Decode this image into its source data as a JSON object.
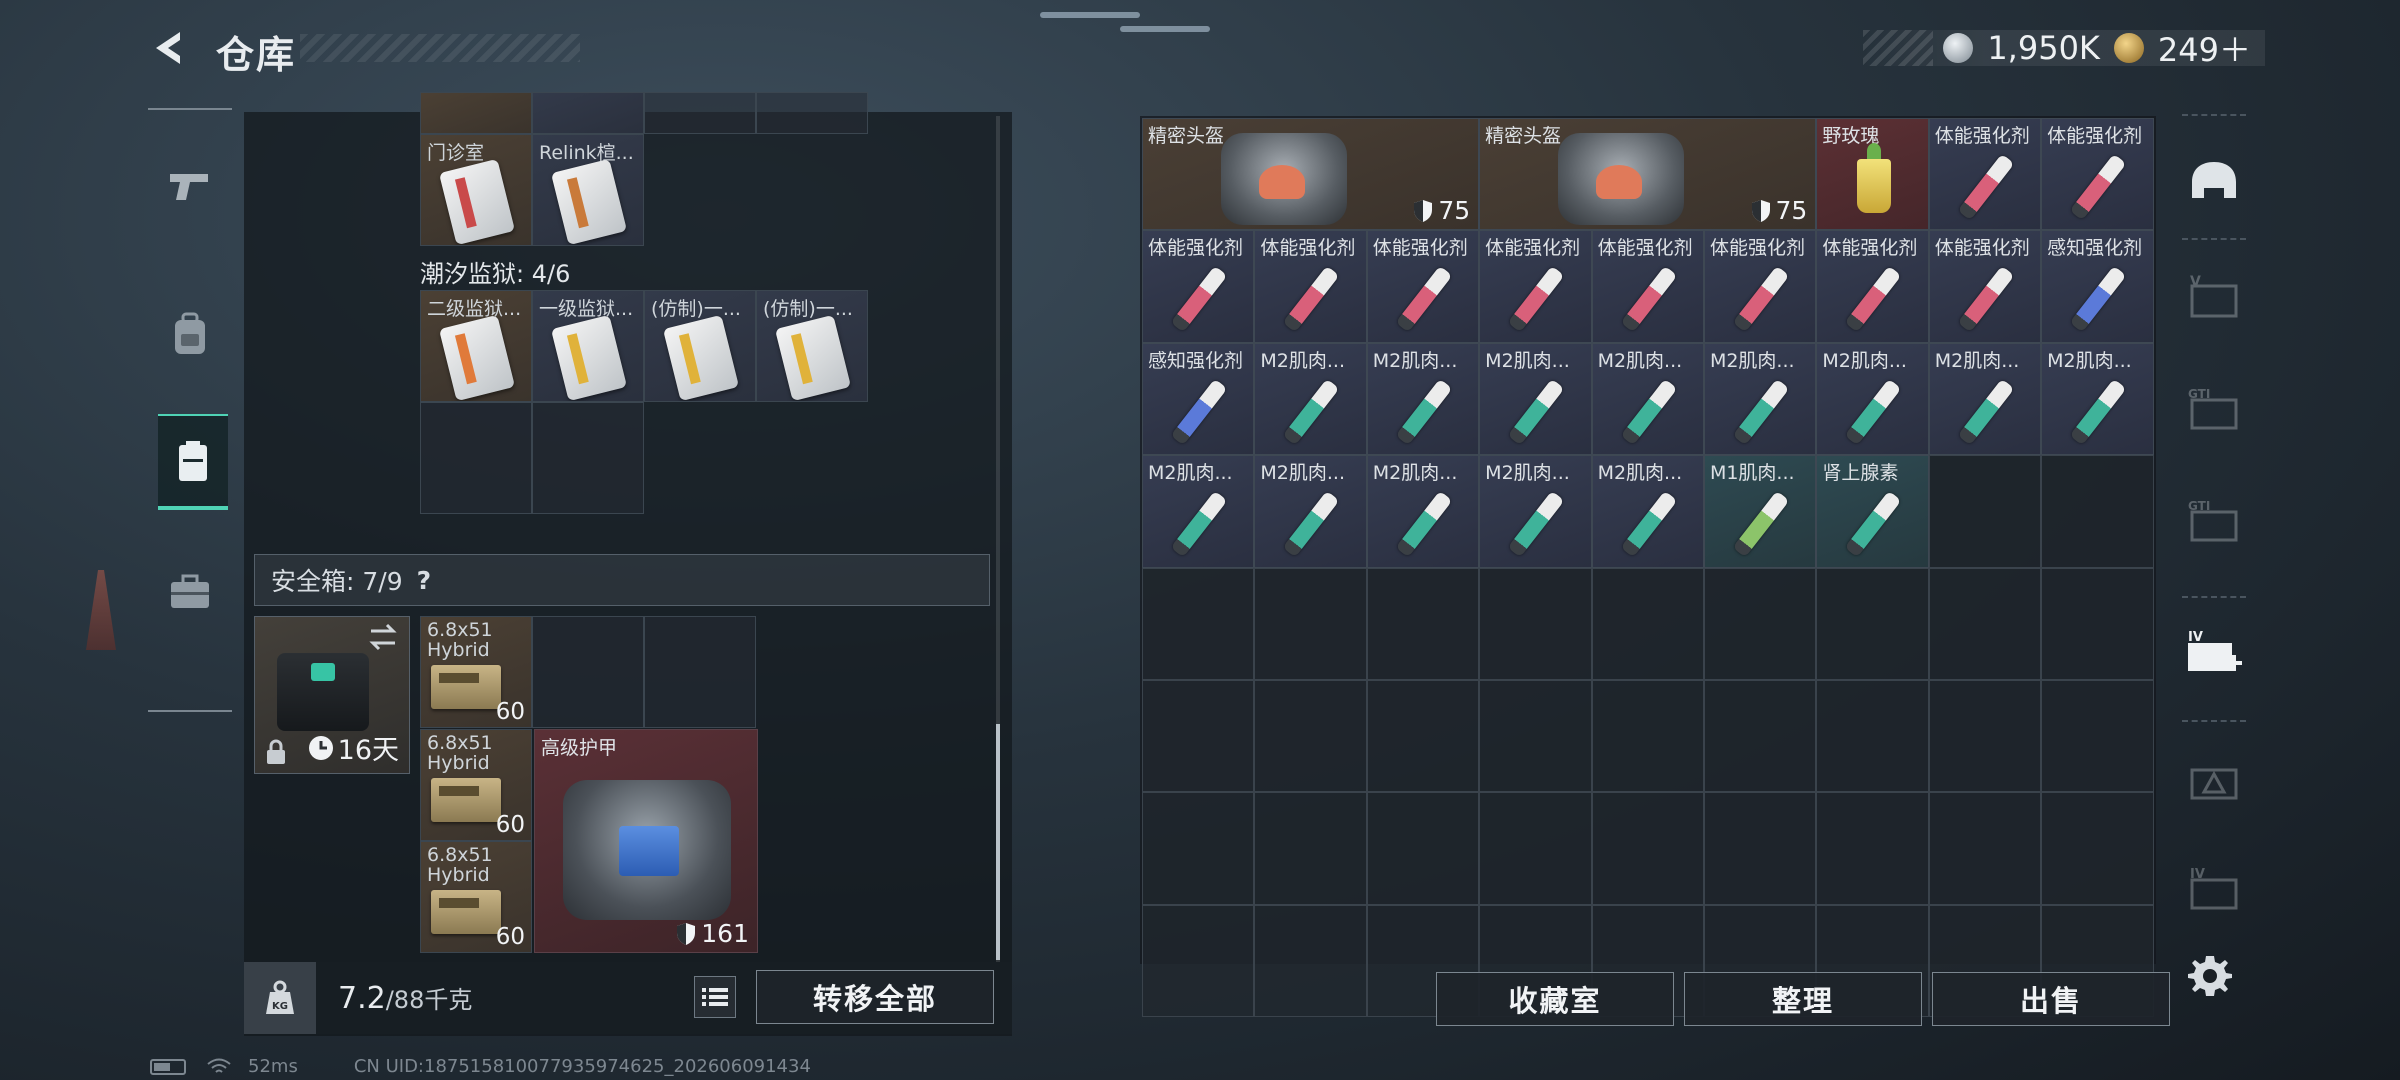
{
  "header": {
    "title": "仓库",
    "currency": [
      {
        "icon": "silver-coin-icon",
        "value": "1,950K"
      },
      {
        "icon": "gold-coin-icon",
        "value": "249＋"
      }
    ]
  },
  "left_nav": [
    {
      "icon": "pistol-icon",
      "active": false
    },
    {
      "icon": "backpack-icon",
      "active": false
    },
    {
      "icon": "storage-locker-icon",
      "active": true
    },
    {
      "icon": "briefcase-icon",
      "active": false
    }
  ],
  "left_panel": {
    "top_items": [
      {
        "label": "门诊室",
        "color": "#c94a4a"
      },
      {
        "label": "Relink楦...",
        "color": "#c97a3a"
      }
    ],
    "prison_section": {
      "title": "潮汐监狱: 4/6",
      "items": [
        {
          "label": "二级监狱...",
          "color": "#e07a3a"
        },
        {
          "label": "一级监狱...",
          "color": "#e0b23a"
        },
        {
          "label": "(仿制)一...",
          "color": "#e0b23a"
        },
        {
          "label": "(仿制)一...",
          "color": "#e0b23a"
        }
      ]
    },
    "safe_box": {
      "title": "安全箱: 7/9",
      "help": "?",
      "timer": "16天",
      "ammo": [
        {
          "label": "6.8x51 Hybrid",
          "count": "60"
        },
        {
          "label": "6.8x51 Hybrid",
          "count": "60"
        },
        {
          "label": "6.8x51 Hybrid",
          "count": "60"
        }
      ],
      "armor": {
        "label": "高级护甲",
        "durability": "161"
      }
    },
    "footer": {
      "weight_value": "7.2",
      "weight_cap": "/88千克",
      "transfer_all": "转移全部"
    }
  },
  "stash": {
    "rows": [
      [
        {
          "label": "精密头盔",
          "kind": "helmet",
          "value": "75",
          "span": 3
        },
        {
          "label": "精密头盔",
          "kind": "helmet",
          "value": "75",
          "span": 3
        },
        {
          "label": "野玫瑰",
          "kind": "drink"
        },
        {
          "label": "体能强化剂",
          "kind": "syringe",
          "color": "#d9607a"
        },
        {
          "label": "体能强化剂",
          "kind": "syringe",
          "color": "#d9607a"
        }
      ],
      [
        {
          "label": "体能强化剂",
          "kind": "syringe",
          "color": "#d9607a"
        },
        {
          "label": "体能强化剂",
          "kind": "syringe",
          "color": "#d9607a"
        },
        {
          "label": "体能强化剂",
          "kind": "syringe",
          "color": "#d9607a"
        },
        {
          "label": "体能强化剂",
          "kind": "syringe",
          "color": "#d9607a"
        },
        {
          "label": "体能强化剂",
          "kind": "syringe",
          "color": "#d9607a"
        },
        {
          "label": "体能强化剂",
          "kind": "syringe",
          "color": "#d9607a"
        },
        {
          "label": "体能强化剂",
          "kind": "syringe",
          "color": "#d9607a"
        },
        {
          "label": "体能强化剂",
          "kind": "syringe",
          "color": "#d9607a"
        },
        {
          "label": "感知强化剂",
          "kind": "syringe",
          "color": "#5b7ad9"
        }
      ],
      [
        {
          "label": "感知强化剂",
          "kind": "syringe",
          "color": "#5b7ad9"
        },
        {
          "label": "M2肌肉...",
          "kind": "syringe",
          "color": "#3fb39a"
        },
        {
          "label": "M2肌肉...",
          "kind": "syringe",
          "color": "#3fb39a"
        },
        {
          "label": "M2肌肉...",
          "kind": "syringe",
          "color": "#3fb39a"
        },
        {
          "label": "M2肌肉...",
          "kind": "syringe",
          "color": "#3fb39a"
        },
        {
          "label": "M2肌肉...",
          "kind": "syringe",
          "color": "#3fb39a"
        },
        {
          "label": "M2肌肉...",
          "kind": "syringe",
          "color": "#3fb39a"
        },
        {
          "label": "M2肌肉...",
          "kind": "syringe",
          "color": "#3fb39a"
        },
        {
          "label": "M2肌肉...",
          "kind": "syringe",
          "color": "#3fb39a"
        }
      ],
      [
        {
          "label": "M2肌肉...",
          "kind": "syringe",
          "color": "#3fb39a"
        },
        {
          "label": "M2肌肉...",
          "kind": "syringe",
          "color": "#3fb39a"
        },
        {
          "label": "M2肌肉...",
          "kind": "syringe",
          "color": "#3fb39a"
        },
        {
          "label": "M2肌肉...",
          "kind": "syringe",
          "color": "#3fb39a"
        },
        {
          "label": "M2肌肉...",
          "kind": "syringe",
          "color": "#3fb39a"
        },
        {
          "label": "M1肌肉...",
          "kind": "syringe",
          "color": "#8cc46a",
          "tint": "teal"
        },
        {
          "label": "肾上腺素",
          "kind": "syringe",
          "color": "#3fb39a",
          "tint": "teal"
        }
      ]
    ],
    "empty_rows": 4,
    "buttons": {
      "collection": "收藏室",
      "sort": "整理",
      "sell": "出售"
    }
  },
  "right_rail": [
    {
      "icon": "helmet-slot-icon",
      "dim": false
    },
    {
      "icon": "v-tier-card-icon",
      "dim": true
    },
    {
      "icon": "gti-card-icon",
      "dim": true
    },
    {
      "icon": "gti-card-icon",
      "dim": true
    },
    {
      "icon": "iv-add-card-icon",
      "dim": false
    },
    {
      "icon": "gti-warning-card-icon",
      "dim": true
    },
    {
      "icon": "iv-card-icon",
      "dim": true
    }
  ],
  "status_bar": {
    "ping": "52ms",
    "uid": "CN UID:18751581007793597462​5_202606091434"
  }
}
